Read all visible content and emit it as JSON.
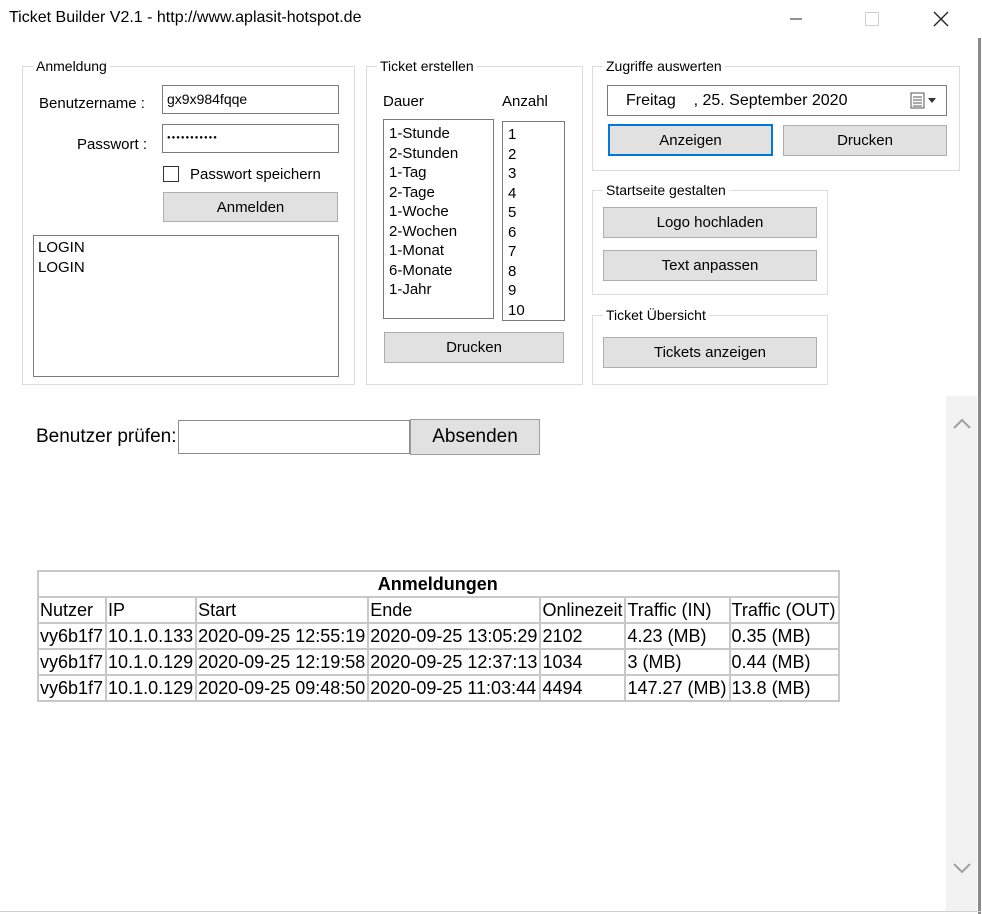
{
  "window": {
    "title": "Ticket Builder V2.1 - http://www.aplasit-hotspot.de"
  },
  "login": {
    "legend": "Anmeldung",
    "username_label": "Benutzername :",
    "username_value": "gx9x984fqqe",
    "password_label": "Passwort :",
    "password_value": "●●●●●●●●●●●",
    "remember_label": "Passwort speichern",
    "remember_checked": false,
    "login_button": "Anmelden",
    "log_lines": [
      "LOGIN",
      "LOGIN"
    ]
  },
  "ticket": {
    "legend": "Ticket erstellen",
    "duration_label": "Dauer",
    "count_label": "Anzahl",
    "durations": [
      "1-Stunde",
      "2-Stunden",
      "1-Tag",
      "2-Tage",
      "1-Woche",
      "2-Wochen",
      "1-Monat",
      "6-Monate",
      "1-Jahr"
    ],
    "counts": [
      "1",
      "2",
      "3",
      "4",
      "5",
      "6",
      "7",
      "8",
      "9",
      "10"
    ],
    "print_button": "Drucken"
  },
  "access": {
    "legend": "Zugriffe auswerten",
    "date_value": "Freitag    , 25. September 2020",
    "show_button": "Anzeigen",
    "print_button": "Drucken"
  },
  "startpage": {
    "legend": "Startseite gestalten",
    "logo_button": "Logo hochladen",
    "text_button": "Text anpassen"
  },
  "overview": {
    "legend": "Ticket Übersicht",
    "show_button": "Tickets anzeigen"
  },
  "user_check": {
    "label": "Benutzer prüfen:",
    "value": "",
    "submit_button": "Absenden"
  },
  "logins_table": {
    "caption": "Anmeldungen",
    "columns": [
      "Nutzer",
      "IP",
      "Start",
      "Ende",
      "Onlinezeit",
      "Traffic (IN)",
      "Traffic (OUT)"
    ],
    "rows": [
      [
        "vy6b1f7",
        "10.1.0.133",
        "2020-09-25 12:55:19",
        "2020-09-25 13:05:29",
        "2102",
        "4.23 (MB)",
        "0.35 (MB)"
      ],
      [
        "vy6b1f7",
        "10.1.0.129",
        "2020-09-25 12:19:58",
        "2020-09-25 12:37:13",
        "1034",
        "3 (MB)",
        "0.44 (MB)"
      ],
      [
        "vy6b1f7",
        "10.1.0.129",
        "2020-09-25 09:48:50",
        "2020-09-25 11:03:44",
        "4494",
        "147.27 (MB)",
        "13.8 (MB)"
      ]
    ]
  }
}
